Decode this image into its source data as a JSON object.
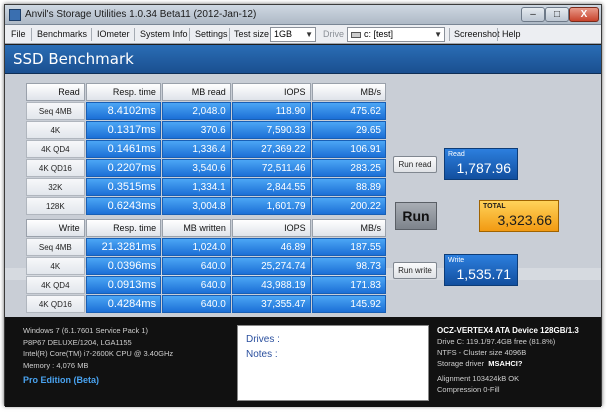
{
  "window": {
    "title": "Anvil's Storage Utilities 1.0.34 Beta11 (2012-Jan-12)",
    "controls": {
      "minimize": "–",
      "maximize": "□",
      "close": "X"
    }
  },
  "menu": {
    "file": "File",
    "benchmarks": "Benchmarks",
    "iometer": "IOmeter",
    "system_info": "System Info",
    "settings": "Settings",
    "test_size_label": "Test size",
    "test_size_value": "1GB",
    "drive_label": "Drive",
    "drive_value": "c: [test]",
    "screenshot": "Screenshot",
    "help": "Help"
  },
  "header": {
    "title": "SSD Benchmark"
  },
  "read": {
    "headers": [
      "Read",
      "Resp. time",
      "MB read",
      "IOPS",
      "MB/s"
    ],
    "rows": [
      {
        "label": "Seq 4MB",
        "resp": "8.4102ms",
        "mb": "2,048.0",
        "iops": "118.90",
        "mbs": "475.62"
      },
      {
        "label": "4K",
        "resp": "0.1317ms",
        "mb": "370.6",
        "iops": "7,590.33",
        "mbs": "29.65"
      },
      {
        "label": "4K QD4",
        "resp": "0.1461ms",
        "mb": "1,336.4",
        "iops": "27,369.22",
        "mbs": "106.91"
      },
      {
        "label": "4K QD16",
        "resp": "0.2207ms",
        "mb": "3,540.6",
        "iops": "72,511.46",
        "mbs": "283.25"
      },
      {
        "label": "32K",
        "resp": "0.3515ms",
        "mb": "1,334.1",
        "iops": "2,844.55",
        "mbs": "88.89"
      },
      {
        "label": "128K",
        "resp": "0.6243ms",
        "mb": "3,004.8",
        "iops": "1,601.79",
        "mbs": "200.22"
      }
    ],
    "run_button": "Run read",
    "score_caption": "Read",
    "score": "1,787.96"
  },
  "write": {
    "headers": [
      "Write",
      "Resp. time",
      "MB written",
      "IOPS",
      "MB/s"
    ],
    "rows": [
      {
        "label": "Seq 4MB",
        "resp": "21.3281ms",
        "mb": "1,024.0",
        "iops": "46.89",
        "mbs": "187.55"
      },
      {
        "label": "4K",
        "resp": "0.0396ms",
        "mb": "640.0",
        "iops": "25,274.74",
        "mbs": "98.73"
      },
      {
        "label": "4K QD4",
        "resp": "0.0913ms",
        "mb": "640.0",
        "iops": "43,988.19",
        "mbs": "171.83"
      },
      {
        "label": "4K QD16",
        "resp": "0.4284ms",
        "mb": "640.0",
        "iops": "37,355.47",
        "mbs": "145.92"
      }
    ],
    "run_button": "Run write",
    "score_caption": "Write",
    "score": "1,535.71"
  },
  "run": {
    "label": "Run"
  },
  "total": {
    "caption": "TOTAL",
    "score": "3,323.66"
  },
  "system": {
    "os": "Windows 7 (6.1.7601 Service Pack 1)",
    "board": "P8P67 DELUXE/1204, LGA1155",
    "cpu": "Intel(R) Core(TM) i7-2600K CPU @ 3.40GHz",
    "memory": "Memory : 4,076 MB",
    "edition": "Pro Edition (Beta)"
  },
  "notes": {
    "drives_label": "Drives :",
    "notes_label": "Notes :"
  },
  "device": {
    "name": "OCZ-VERTEX4 ATA Device 128GB/1.3",
    "drive": "Drive C: 119.1/97.4GB free (81.8%)",
    "fs": "NTFS - Cluster size 4096B",
    "driver_label": "Storage driver",
    "driver": "MSAHCI?",
    "alignment": "Alignment 103424kB OK",
    "compression": "Compression 0-Fill"
  }
}
